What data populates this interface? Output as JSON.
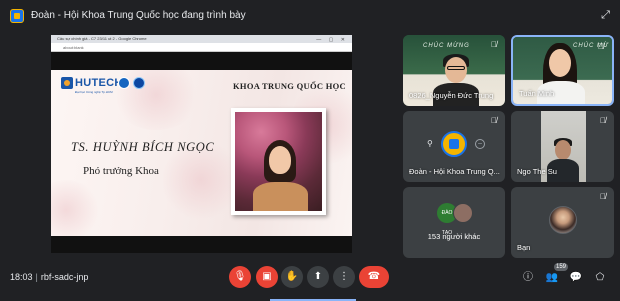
{
  "topbar": {
    "presenting_text": "Đoàn - Hội Khoa Trung Quốc học đang trình bày"
  },
  "shared_screen": {
    "window_title": "Câu sự chính giả - C7 23/11 ut 2 - Google Chrome",
    "url": "about:blank",
    "slide": {
      "logo_text": "HUTECH",
      "logo_subtext": "Đại học Công nghệ Tp.HCM",
      "department": "KHOA TRUNG QUỐC HỌC",
      "name": "TS. HUỲNH BÍCH NGỌC",
      "role": "Phó trưởng Khoa"
    }
  },
  "participants": [
    {
      "name": "0826_Nguyễn Đức Trung",
      "muted": true,
      "board_text": "CHÚC MỪNG"
    },
    {
      "name": "Tuấn Minh",
      "muted": true,
      "active_speaker": true,
      "board_text": "CHÚC MỪ"
    },
    {
      "name": "Đoàn - Hội Khoa Trung Q...",
      "muted": true
    },
    {
      "name": "Ngo The Su",
      "muted": true
    },
    {
      "name": "153 người khác",
      "avatar_label": "ĐÀO TẠO"
    },
    {
      "name": "Bạn",
      "muted": true
    }
  ],
  "bottombar": {
    "time": "18:03",
    "meeting_code": "rbf-sadc-jnp",
    "participants_count": "159",
    "controls": [
      "mic-off",
      "camera-off",
      "raise-hand",
      "present",
      "more-options",
      "leave-call"
    ],
    "right_icons": [
      "info",
      "people",
      "chat",
      "activities"
    ]
  },
  "colors": {
    "background": "#202124",
    "tile": "#3c4043",
    "danger": "#ea4335",
    "accent": "#8ab4f8"
  }
}
